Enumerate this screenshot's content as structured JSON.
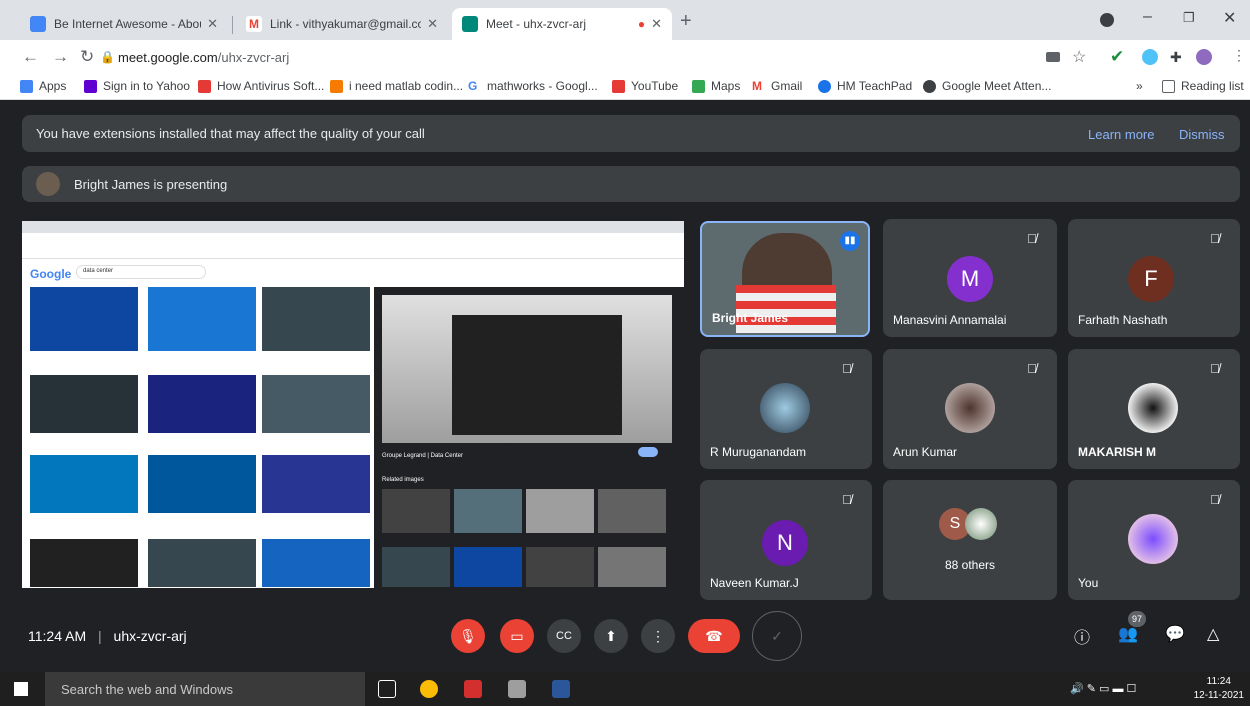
{
  "browser": {
    "tabs": [
      {
        "title": "Be Internet Awesome - About",
        "active": false
      },
      {
        "title": "Link - vithyakumar@gmail.com",
        "active": false
      },
      {
        "title": "Meet - uhx-zvcr-arj",
        "active": true
      }
    ],
    "url_host": "meet.google.com",
    "url_path": "/uhx-zvcr-arj",
    "bookmarks": [
      "Apps",
      "Sign in to Yahoo",
      "How Antivirus Soft...",
      "i need matlab codin...",
      "mathworks - Googl...",
      "YouTube",
      "Maps",
      "Gmail",
      "HM TeachPad",
      "Google Meet Atten..."
    ],
    "reading_list": "Reading list"
  },
  "meet": {
    "extension_banner": "You have extensions installed that may affect the quality of your call",
    "learn_more": "Learn more",
    "dismiss": "Dismiss",
    "presenting_text": "Bright James is presenting",
    "participants": [
      {
        "name": "Bright James",
        "type": "video"
      },
      {
        "name": "Manasvini Annamalai",
        "initial": "M",
        "color": "#8430ce"
      },
      {
        "name": "Farhath Nashath",
        "initial": "F",
        "color": "#6e2e20"
      },
      {
        "name": "R Muruganandam",
        "type": "photo"
      },
      {
        "name": "Arun Kumar",
        "type": "photo"
      },
      {
        "name": "MAKARISH M",
        "type": "photo"
      },
      {
        "name": "Naveen Kumar.J",
        "initial": "N",
        "color": "#6a1bb0"
      },
      {
        "name": "88 others",
        "initial": "S",
        "color": "#a05a4a"
      },
      {
        "name": "You",
        "type": "photo"
      }
    ],
    "time": "11:24 AM",
    "meeting_code": "uhx-zvcr-arj",
    "people_count": "97"
  },
  "presentation": {
    "search_query": "data center",
    "logo": "Google",
    "preview_title": "Groupe Legrand | Data Center",
    "related_label": "Related images"
  },
  "taskbar": {
    "search_placeholder": "Search the web and Windows",
    "clock_time": "11:24",
    "clock_date": "12-11-2021"
  }
}
